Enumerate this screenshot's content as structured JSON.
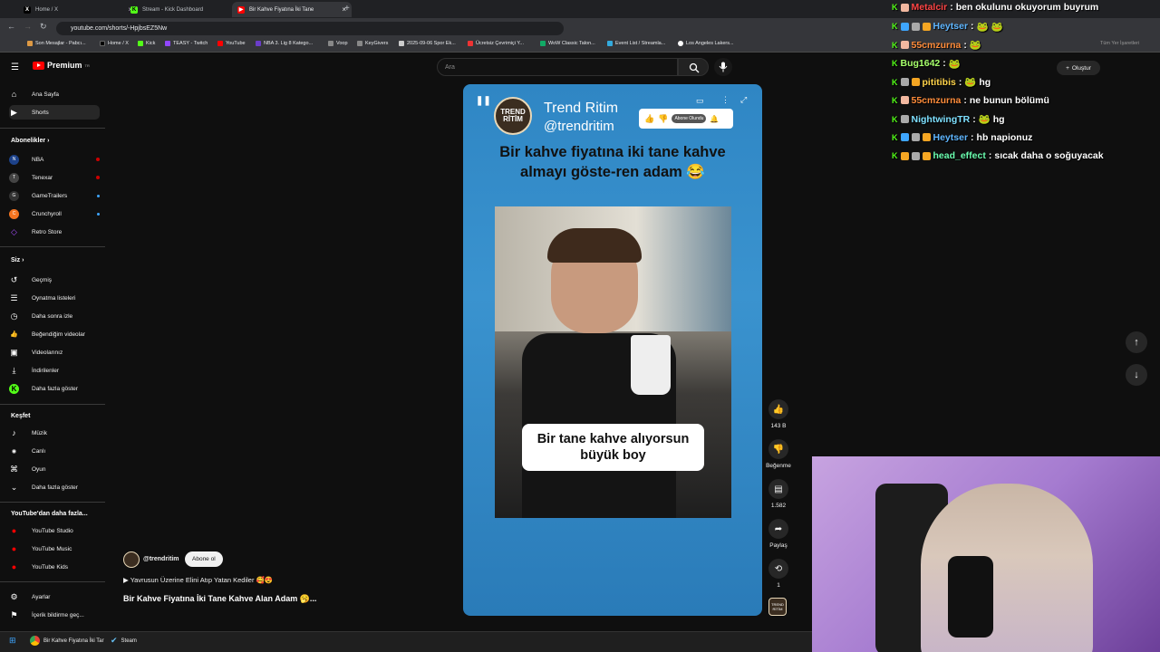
{
  "browser": {
    "tabs": [
      {
        "label": "Home / X",
        "favicon": "X",
        "color": "#000000"
      },
      {
        "label": "Stream - Kick Dashboard",
        "favicon": "K",
        "color": "#53fc18"
      },
      {
        "label": "Bir Kahve Fiyatına İki Tane",
        "favicon": "▶",
        "color": "#ff0000"
      }
    ],
    "url": "youtube.com/shorts/-HpjbsEZ5Nw",
    "bookmarks": [
      "Son Mesajlar - Pabcı...",
      "Home / X",
      "Kick",
      "TEASY - Twitch",
      "YouTube",
      "NBA 3. Lig 8 Katego...",
      "Voop",
      "KeyGivers",
      "2025-09-06 Spor Ek...",
      "Ücretsiz Çevrimiçi Y...",
      "WoW Classic Talon...",
      "Event List / Streamla...",
      "Los Angeles Lakers..."
    ],
    "all_bookmarks": "Tüm Yer İşaretleri"
  },
  "youtube": {
    "logo_text": "Premium",
    "logo_badge": "TR",
    "search_placeholder": "Ara",
    "create_label": "Oluştur",
    "sidebar": {
      "top": [
        {
          "label": "Ana Sayfa",
          "icon": "home-icon",
          "glyph": "⌂"
        },
        {
          "label": "Shorts",
          "icon": "shorts-icon",
          "glyph": "▶"
        }
      ],
      "subs_header": "Abonelikler",
      "subs": [
        {
          "label": "NBA",
          "dot": "#cc0000"
        },
        {
          "label": "Tenexar",
          "dot": "#cc0000"
        },
        {
          "label": "GameTrailers",
          "dot": "#3ea6ff"
        },
        {
          "label": "Crunchyroll",
          "dot": "#3ea6ff"
        },
        {
          "label": "Retro Store",
          "dot": ""
        }
      ],
      "you_header": "Siz",
      "you": [
        {
          "label": "Geçmiş",
          "glyph": "↺"
        },
        {
          "label": "Oynatma listeleri",
          "glyph": "☰"
        },
        {
          "label": "Daha sonra izle",
          "glyph": "◷"
        },
        {
          "label": "Beğendiğim videolar",
          "glyph": "👍"
        },
        {
          "label": "Videolarınız",
          "glyph": "▣"
        },
        {
          "label": "İndirilenler",
          "glyph": "⤓"
        },
        {
          "label": "Daha fazla göster",
          "glyph": "⌄"
        }
      ],
      "explore_header": "Keşfet",
      "explore": [
        {
          "label": "Müzik",
          "glyph": "♪"
        },
        {
          "label": "Canlı",
          "glyph": "((•))"
        },
        {
          "label": "Oyun",
          "glyph": "⌘"
        },
        {
          "label": "Daha fazla göster",
          "glyph": "⌄"
        }
      ],
      "more_header": "YouTube'dan daha fazla...",
      "more": [
        {
          "label": "YouTube Studio"
        },
        {
          "label": "YouTube Music"
        },
        {
          "label": "YouTube Kids"
        }
      ],
      "bottom": [
        {
          "label": "Ayarlar",
          "glyph": "⚙"
        },
        {
          "label": "İçerik bildirme geç...",
          "glyph": "⚑"
        }
      ]
    },
    "short": {
      "channel_name": "Trend Ritim",
      "channel_handle": "@trendritim",
      "logo_text": "TREND RİTİM",
      "caption_top": "Bir kahve fiyatına iki tane kahve almayı göste-ren adam 😂",
      "subtitle": "Bir tane kahve alıyorsun büyük boy",
      "overlay_sub_label": "Abone Olundu"
    },
    "actions": {
      "likes": "143 B",
      "dislike_label": "Beğenme",
      "comments": "1.582",
      "share_label": "Paylaş",
      "remix_count": "1"
    },
    "meta": {
      "channel": "@trendritim",
      "subscribe_label": "Abone ol",
      "related_line": "▶ Yavrusun Üzerine Elini Atıp Yatan Kediler 🥰😍",
      "title": "Bir Kahve Fiyatına İki Tane Kahve Alan Adam 🥱..."
    }
  },
  "chat": [
    {
      "user": "Metalcir",
      "color": "#ff4545",
      "msg": "ben okulunu okuyorum buyrum",
      "badges": [
        "#f2b8a0"
      ]
    },
    {
      "user": "Heytser",
      "color": "#5fb6ff",
      "msg": "🐸 🐸",
      "badges": [
        "#3ea6ff",
        "#aaaaaa",
        "#f5a623"
      ]
    },
    {
      "user": "55cmzurna",
      "color": "#ff8c3a",
      "msg": "🐸",
      "badges": [
        "#f2b8a0"
      ]
    },
    {
      "user": "Bug1642",
      "color": "#a6ff6b",
      "msg": "🐸",
      "badges": []
    },
    {
      "user": "pititibis",
      "color": "#ffd34a",
      "msg": "🐸 hg",
      "badges": [
        "#aaaaaa",
        "#f5a623"
      ]
    },
    {
      "user": "55cmzurna",
      "color": "#ff8c3a",
      "msg": "ne bunun bölümü",
      "badges": [
        "#f2b8a0"
      ]
    },
    {
      "user": "NightwingTR",
      "color": "#7ee0ff",
      "msg": "🐸 hg",
      "badges": [
        "#aaaaaa"
      ]
    },
    {
      "user": "Heytser",
      "color": "#5fb6ff",
      "msg": "hb napionuz",
      "badges": [
        "#3ea6ff",
        "#aaaaaa",
        "#f5a623"
      ]
    },
    {
      "user": "head_effect",
      "color": "#6bffb0",
      "msg": "sıcak daha o soğuyacak",
      "badges": [
        "#f5a623",
        "#aaaaaa",
        "#f5a623"
      ]
    }
  ],
  "taskbar": {
    "items": [
      "Bir Kahve Fiyatına İki Tar",
      "Steam"
    ]
  }
}
